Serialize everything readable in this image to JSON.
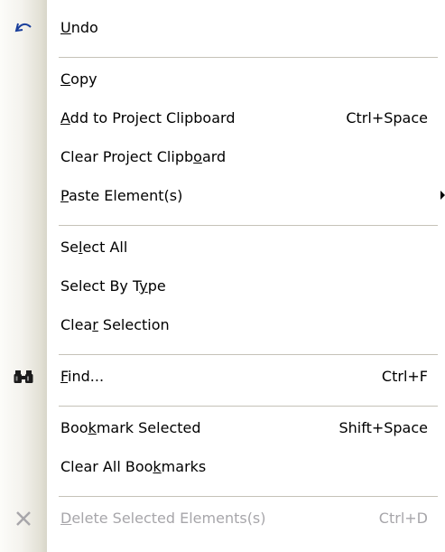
{
  "menu": {
    "items": [
      {
        "label": "Undo",
        "mnemonic": 0,
        "shortcut": "",
        "icon": "undo-icon",
        "disabled": false,
        "submenu": false
      },
      {
        "label": "Copy",
        "mnemonic": 0,
        "shortcut": "",
        "icon": "",
        "disabled": false,
        "submenu": false
      },
      {
        "label": "Add to Project Clipboard",
        "mnemonic": 0,
        "shortcut": "Ctrl+Space",
        "icon": "",
        "disabled": false,
        "submenu": false
      },
      {
        "label": "Clear Project Clipboard",
        "mnemonic": 19,
        "shortcut": "",
        "icon": "",
        "disabled": false,
        "submenu": false
      },
      {
        "label": "Paste Element(s)",
        "mnemonic": 0,
        "shortcut": "",
        "icon": "",
        "disabled": false,
        "submenu": true
      },
      {
        "label": "Select All",
        "mnemonic": 2,
        "shortcut": "",
        "icon": "",
        "disabled": false,
        "submenu": false
      },
      {
        "label": "Select By Type",
        "mnemonic": 11,
        "shortcut": "",
        "icon": "",
        "disabled": false,
        "submenu": false
      },
      {
        "label": "Clear Selection",
        "mnemonic": 4,
        "shortcut": "",
        "icon": "",
        "disabled": false,
        "submenu": false
      },
      {
        "label": "Find...",
        "mnemonic": 0,
        "shortcut": "Ctrl+F",
        "icon": "binoculars-icon",
        "disabled": false,
        "submenu": false
      },
      {
        "label": "Bookmark Selected",
        "mnemonic": 3,
        "shortcut": "Shift+Space",
        "icon": "",
        "disabled": false,
        "submenu": false
      },
      {
        "label": "Clear All Bookmarks",
        "mnemonic": 13,
        "shortcut": "",
        "icon": "",
        "disabled": false,
        "submenu": false
      },
      {
        "label": "Delete Selected Elements(s)",
        "mnemonic": 0,
        "shortcut": "Ctrl+D",
        "icon": "delete-x-icon",
        "disabled": true,
        "submenu": false
      }
    ]
  },
  "colors": {
    "text": "#000000",
    "disabled_text": "#a7a6aa",
    "separator": "#c5c2b8",
    "gutter_dark": "#d8d6c9",
    "undo_icon": "#1a3f9c"
  }
}
